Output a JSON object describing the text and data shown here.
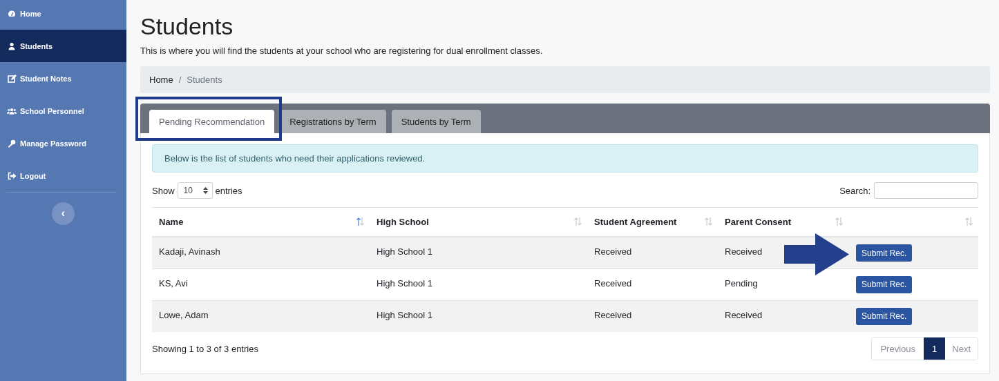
{
  "sidebar": {
    "items": [
      {
        "label": "Home",
        "selected": false
      },
      {
        "label": "Students",
        "selected": true
      },
      {
        "label": "Student Notes",
        "selected": false
      },
      {
        "label": "School Personnel",
        "selected": false
      },
      {
        "label": "Manage Password",
        "selected": false
      },
      {
        "label": "Logout",
        "selected": false
      }
    ],
    "collapse_button": "‹"
  },
  "page": {
    "title": "Students",
    "description": "This is where you will find the students at your school who are registering for dual enrollment classes."
  },
  "breadcrumb": {
    "separator": "/",
    "items": [
      {
        "label": "Home"
      },
      {
        "label": "Students"
      }
    ]
  },
  "tabs": [
    {
      "label": "Pending Recommendation",
      "selected": true,
      "highlighted": true
    },
    {
      "label": "Registrations by Term",
      "selected": false,
      "highlighted": false
    },
    {
      "label": "Students by Term",
      "selected": false,
      "highlighted": false
    }
  ],
  "alert": "Below is the list of students who need their applications reviewed.",
  "length_control": {
    "before": "Show",
    "value": "10",
    "after": "entries"
  },
  "search": {
    "label": "Search:"
  },
  "table": {
    "columns": [
      {
        "label": "Name",
        "sorted": true
      },
      {
        "label": "High School",
        "sorted": false
      },
      {
        "label": "Student Agreement",
        "sorted": false
      },
      {
        "label": "Parent Consent",
        "sorted": false
      },
      {
        "sorted": false
      }
    ],
    "rows": [
      {
        "cells": [
          "Kadaji, Avinash",
          "High School 1",
          "Received",
          "Received"
        ],
        "action": "Submit Rec.",
        "pointed": true
      },
      {
        "cells": [
          "KS, Avi",
          "High School 1",
          "Received",
          "Pending"
        ],
        "action": "Submit Rec.",
        "pointed": false
      },
      {
        "cells": [
          "Lowe, Adam",
          "High School 1",
          "Received",
          "Received"
        ],
        "action": "Submit Rec.",
        "pointed": false
      }
    ]
  },
  "info": "Showing 1 to 3 of 3 entries",
  "pagination": {
    "previous": "Previous",
    "pages": [
      {
        "label": "1",
        "selected": true
      }
    ],
    "next": "Next"
  }
}
